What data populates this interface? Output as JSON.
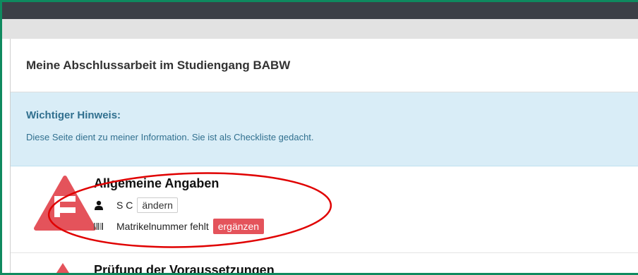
{
  "heading": {
    "title": "Meine Abschlussarbeit im Studiengang BABW"
  },
  "notice": {
    "title": "Wichtiger Hinweis:",
    "text": "Diese Seite dient zu meiner Information. Sie ist als Checkliste gedacht."
  },
  "general": {
    "title": "Allgemeine Angaben",
    "name_value": "S C",
    "change_label": "ändern",
    "matrikel_text": "Matrikelnummer fehlt",
    "add_label": "ergänzen",
    "icons": [
      "warning-triangle-icon",
      "user-icon",
      "barcode-icon"
    ]
  },
  "prerequisites": {
    "title": "Prüfung der Voraussetzungen"
  },
  "colors": {
    "frame_border": "#0f8a5f",
    "top_bar": "#3b3f46",
    "notice_bg": "#d9edf7",
    "notice_text": "#31708f",
    "warning_red": "#e4535b",
    "annotation_red": "#e00000"
  }
}
